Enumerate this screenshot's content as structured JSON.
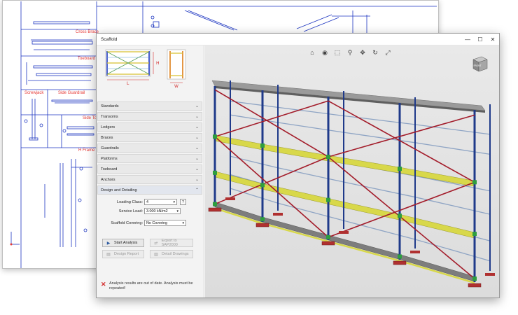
{
  "sheet": {
    "labels": {
      "cross_brace": "Cross Brace",
      "toeboard": "Toeboard",
      "screwjack": "Screwjack",
      "side_guardrail": "Side Guardrail",
      "side_toeboard": "Side Toe",
      "h_frame": "H Frame"
    }
  },
  "window": {
    "title": "Scaffold",
    "controls": {
      "minimize": "—",
      "maximize": "☐",
      "close": "✕"
    }
  },
  "preview": {
    "dim_h": "H",
    "dim_l": "L",
    "dim_w": "W"
  },
  "sections": [
    {
      "label": "Standards",
      "open": false
    },
    {
      "label": "Transoms",
      "open": false
    },
    {
      "label": "Ledgers",
      "open": false
    },
    {
      "label": "Braces",
      "open": false
    },
    {
      "label": "Guardrails",
      "open": false
    },
    {
      "label": "Platforms",
      "open": false
    },
    {
      "label": "Toeboard",
      "open": false
    },
    {
      "label": "Anchors",
      "open": false
    },
    {
      "label": "Design and Detailing",
      "open": true
    }
  ],
  "form": {
    "loading_class_label": "Loading Class:",
    "loading_class_value": "4",
    "help_label": "?",
    "service_load_label": "Service Load:",
    "service_load_value": "3.000 kN/m2",
    "scaffold_covering_label": "Scaffold Covering:",
    "scaffold_covering_value": "No Covering"
  },
  "buttons": {
    "start_analysis": "Start Analysis",
    "export_sap2000": "Export to SAP2000",
    "design_report": "Design Report",
    "detail_drawings": "Detail Drawings"
  },
  "status": {
    "message": "Analysis results are out of date. Analysis must be repeated!",
    "icon": "✕"
  },
  "toolbar": [
    {
      "name": "home-icon",
      "glyph": "⌂"
    },
    {
      "name": "view-icon",
      "glyph": "◉"
    },
    {
      "name": "zoom-window-icon",
      "glyph": "⬚"
    },
    {
      "name": "zoom-icon",
      "glyph": "⚲"
    },
    {
      "name": "pan-icon",
      "glyph": "✥"
    },
    {
      "name": "rotate-icon",
      "glyph": "↻"
    },
    {
      "name": "fullscreen-icon",
      "glyph": "⤢"
    }
  ],
  "viewcube": {
    "front": "FRONT"
  },
  "colors": {
    "standard": "#1f3a8a",
    "brace": "#a31c2a",
    "platform": "#d8d84a",
    "ledger": "#8ea4c4",
    "baseplate": "#b03030",
    "coupler": "#2e9e3e"
  }
}
